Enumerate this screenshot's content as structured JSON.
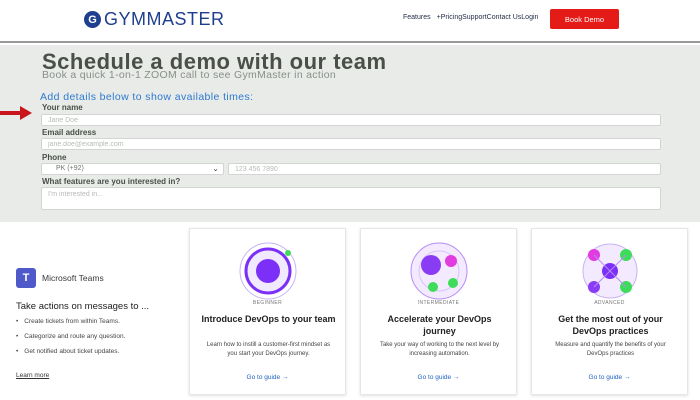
{
  "nav": {
    "logo": "GYMMASTER",
    "logo_mark": "G",
    "links": [
      "Features",
      "Pricing",
      "Support",
      "Contact Us",
      "Login"
    ],
    "book_demo": "Book Demo"
  },
  "demo": {
    "title": "Schedule a demo with our team",
    "subtitle": "Book a quick 1-on-1 ZOOM call to see GymMaster in action",
    "details_heading": "Add details below to show available times:",
    "name_label": "Your name",
    "name_placeholder": "Jane Doe",
    "email_label": "Email address",
    "email_placeholder": "jane.doe@example.com",
    "phone_label": "Phone",
    "country_code": "PK (+92)",
    "phone_placeholder": "123 456 7890",
    "features_label": "What features are you interested in?",
    "features_placeholder": "I'm interested in..."
  },
  "teams": {
    "app_name": "Microsoft Teams",
    "heading": "Take actions on messages to ...",
    "items": [
      "Create tickets from within Teams.",
      "Categorize and route any question.",
      "Get notified about ticket updates."
    ],
    "learn_more": "Learn more"
  },
  "cards": [
    {
      "level": "BEGINNER",
      "title": "Introduce DevOps to your team",
      "desc": "Learn how to instill a customer-first mindset as you start your DevOps journey.",
      "link": "Go to guide →"
    },
    {
      "level": "INTERMEDIATE",
      "title": "Accelerate your DevOps journey",
      "desc": "Take your way of working to the next level by increasing automation.",
      "link": "Go to guide →"
    },
    {
      "level": "ADVANCED",
      "title": "Get the most out of your DevOps practices",
      "desc": "Measure and quantify the benefits of your DevOps practices",
      "link": "Go to guide →"
    }
  ],
  "colors": {
    "brand_blue": "#1e3f8f",
    "book_red": "#e41b17",
    "accent_blue": "#2f7ad0",
    "arrow_red": "#c8171c",
    "purple": "#7b2ff7",
    "green": "#3ddc5a"
  }
}
